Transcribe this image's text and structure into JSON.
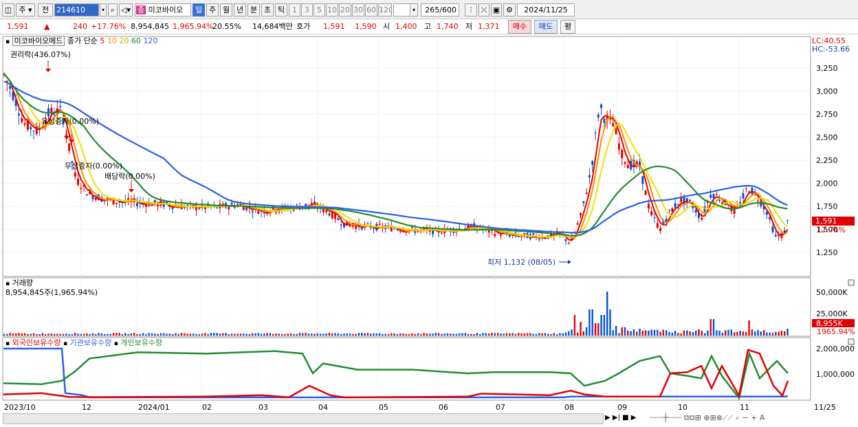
{
  "toolbar": {
    "period_label": "주",
    "whole_label": "전",
    "stock_code": "214610",
    "stock_tag": "종",
    "stock_name": "미코바이오",
    "periods": [
      "일",
      "주",
      "월",
      "년",
      "분",
      "초",
      "틱"
    ],
    "minutes": [
      "1",
      "3",
      "5",
      "10",
      "20",
      "30",
      "60",
      "120"
    ],
    "count_display": "265/600",
    "date_value": "2024/11/25"
  },
  "infobar": {
    "price": "1,591",
    "arrow": "▲",
    "change": "240",
    "change_pct": "+17.76%",
    "volume": "8,954,845",
    "volume_ratio": "1,965.94%",
    "turnover": "20.55%",
    "amount": "14,684백만",
    "quote_label": "호가",
    "ask": "1,591",
    "bid": "1,590",
    "open_label": "시",
    "open": "1,400",
    "high_label": "고",
    "high": "1,740",
    "low_label": "저",
    "low": "1,371",
    "buy_button": "매수",
    "sell_button": "매도",
    "eval_button": "평"
  },
  "price_panel": {
    "title": "미코바이오메드",
    "ma_label": "종가 단순",
    "ma_periods": [
      "5",
      "10",
      "20",
      "60",
      "120"
    ],
    "ma_colors": [
      "#e00000",
      "#ff8c00",
      "#f0e000",
      "#1e8c32",
      "#2a5ee8"
    ],
    "lc": "LC:40.55",
    "hc": "HC:-53.66",
    "y_ticks": [
      "3,250",
      "3,000",
      "2,750",
      "2,500",
      "2,250",
      "2,000",
      "1,750",
      "1,500",
      "1,250"
    ],
    "current_price_tag": "1,591",
    "current_pct_tag": "17.76%",
    "annotations": [
      "권리락(436.07%)",
      "유상증자(0.00%)",
      "무상증자(0.00%)",
      "배당락(0.00%)"
    ],
    "low_mark": "최저 1,132 (08/05)"
  },
  "volume_panel": {
    "title": "거래량",
    "value": "8,954,845주(1,965.94%)",
    "y_ticks": [
      "50,000K",
      "25,000K"
    ],
    "tag_value": "8,955K",
    "tag_pct": "1965.94%"
  },
  "holding_panel": {
    "series": [
      "외국인보유수량",
      "기관보유수량",
      "개인보유수량"
    ],
    "colors": [
      "#e00000",
      "#2a5ee8",
      "#1e8c32"
    ],
    "y_ticks": [
      "2,000,000",
      "1,000,000"
    ]
  },
  "x_axis": [
    "2023/10",
    "12",
    "2024/01",
    "02",
    "03",
    "04",
    "05",
    "06",
    "07",
    "08",
    "09",
    "10",
    "11",
    "11/25"
  ]
}
